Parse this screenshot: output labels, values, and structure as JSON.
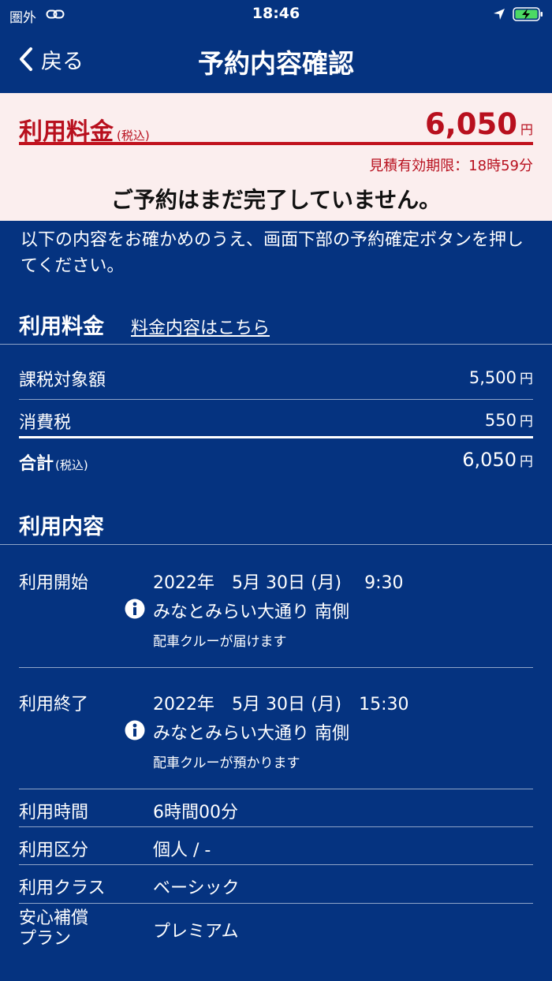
{
  "status_bar": {
    "carrier": "圏外",
    "time": "18:46"
  },
  "nav": {
    "back_label": "戻る",
    "title": "予約内容確認"
  },
  "notice": {
    "fee_label": "利用料金",
    "fee_tax_note": "(税込)",
    "amount": "6,050",
    "amount_unit": "円",
    "expiry": "見積有効期限：18時59分",
    "not_completed": "ご予約はまだ完了していません。"
  },
  "intro_text": "以下の内容をお確かめのうえ、画面下部の予約確定ボタンを押してください。",
  "fee_section": {
    "title": "利用料金",
    "link": "料金内容はこちら",
    "rows": [
      {
        "label": "課税対象額",
        "value": "5,500",
        "unit": "円"
      },
      {
        "label": "消費税",
        "value": "550",
        "unit": "円"
      }
    ],
    "total": {
      "label": "合計",
      "note": "(税込)",
      "value": "6,050",
      "unit": "円"
    }
  },
  "usage_section": {
    "title": "利用内容",
    "start": {
      "label": "利用開始",
      "datetime": "2022年　5月 30日 (月)　 9:30",
      "place": "みなとみらい大通り 南側",
      "note": "配車クルーが届けます"
    },
    "end": {
      "label": "利用終了",
      "datetime": "2022年　5月 30日 (月)　15:30",
      "place": "みなとみらい大通り 南側",
      "note": "配車クルーが預かります"
    },
    "rows": [
      {
        "label": "利用時間",
        "value": "6時間00分"
      },
      {
        "label": "利用区分",
        "value": "個人 / -"
      },
      {
        "label": "利用クラス",
        "value": "ベーシック"
      }
    ],
    "insurance": {
      "label_line1": "安心補償",
      "label_line2": "プラン",
      "value": "プレミアム"
    }
  },
  "colors": {
    "background": "#053380",
    "notice_background": "#fbeeee",
    "accent_red": "#c1121e",
    "battery_green": "#4cd964"
  },
  "icons": {
    "back": "chevron-left-icon",
    "link": "link-icon",
    "location": "location-arrow-icon",
    "battery": "battery-charging-icon",
    "info": "info-icon"
  }
}
